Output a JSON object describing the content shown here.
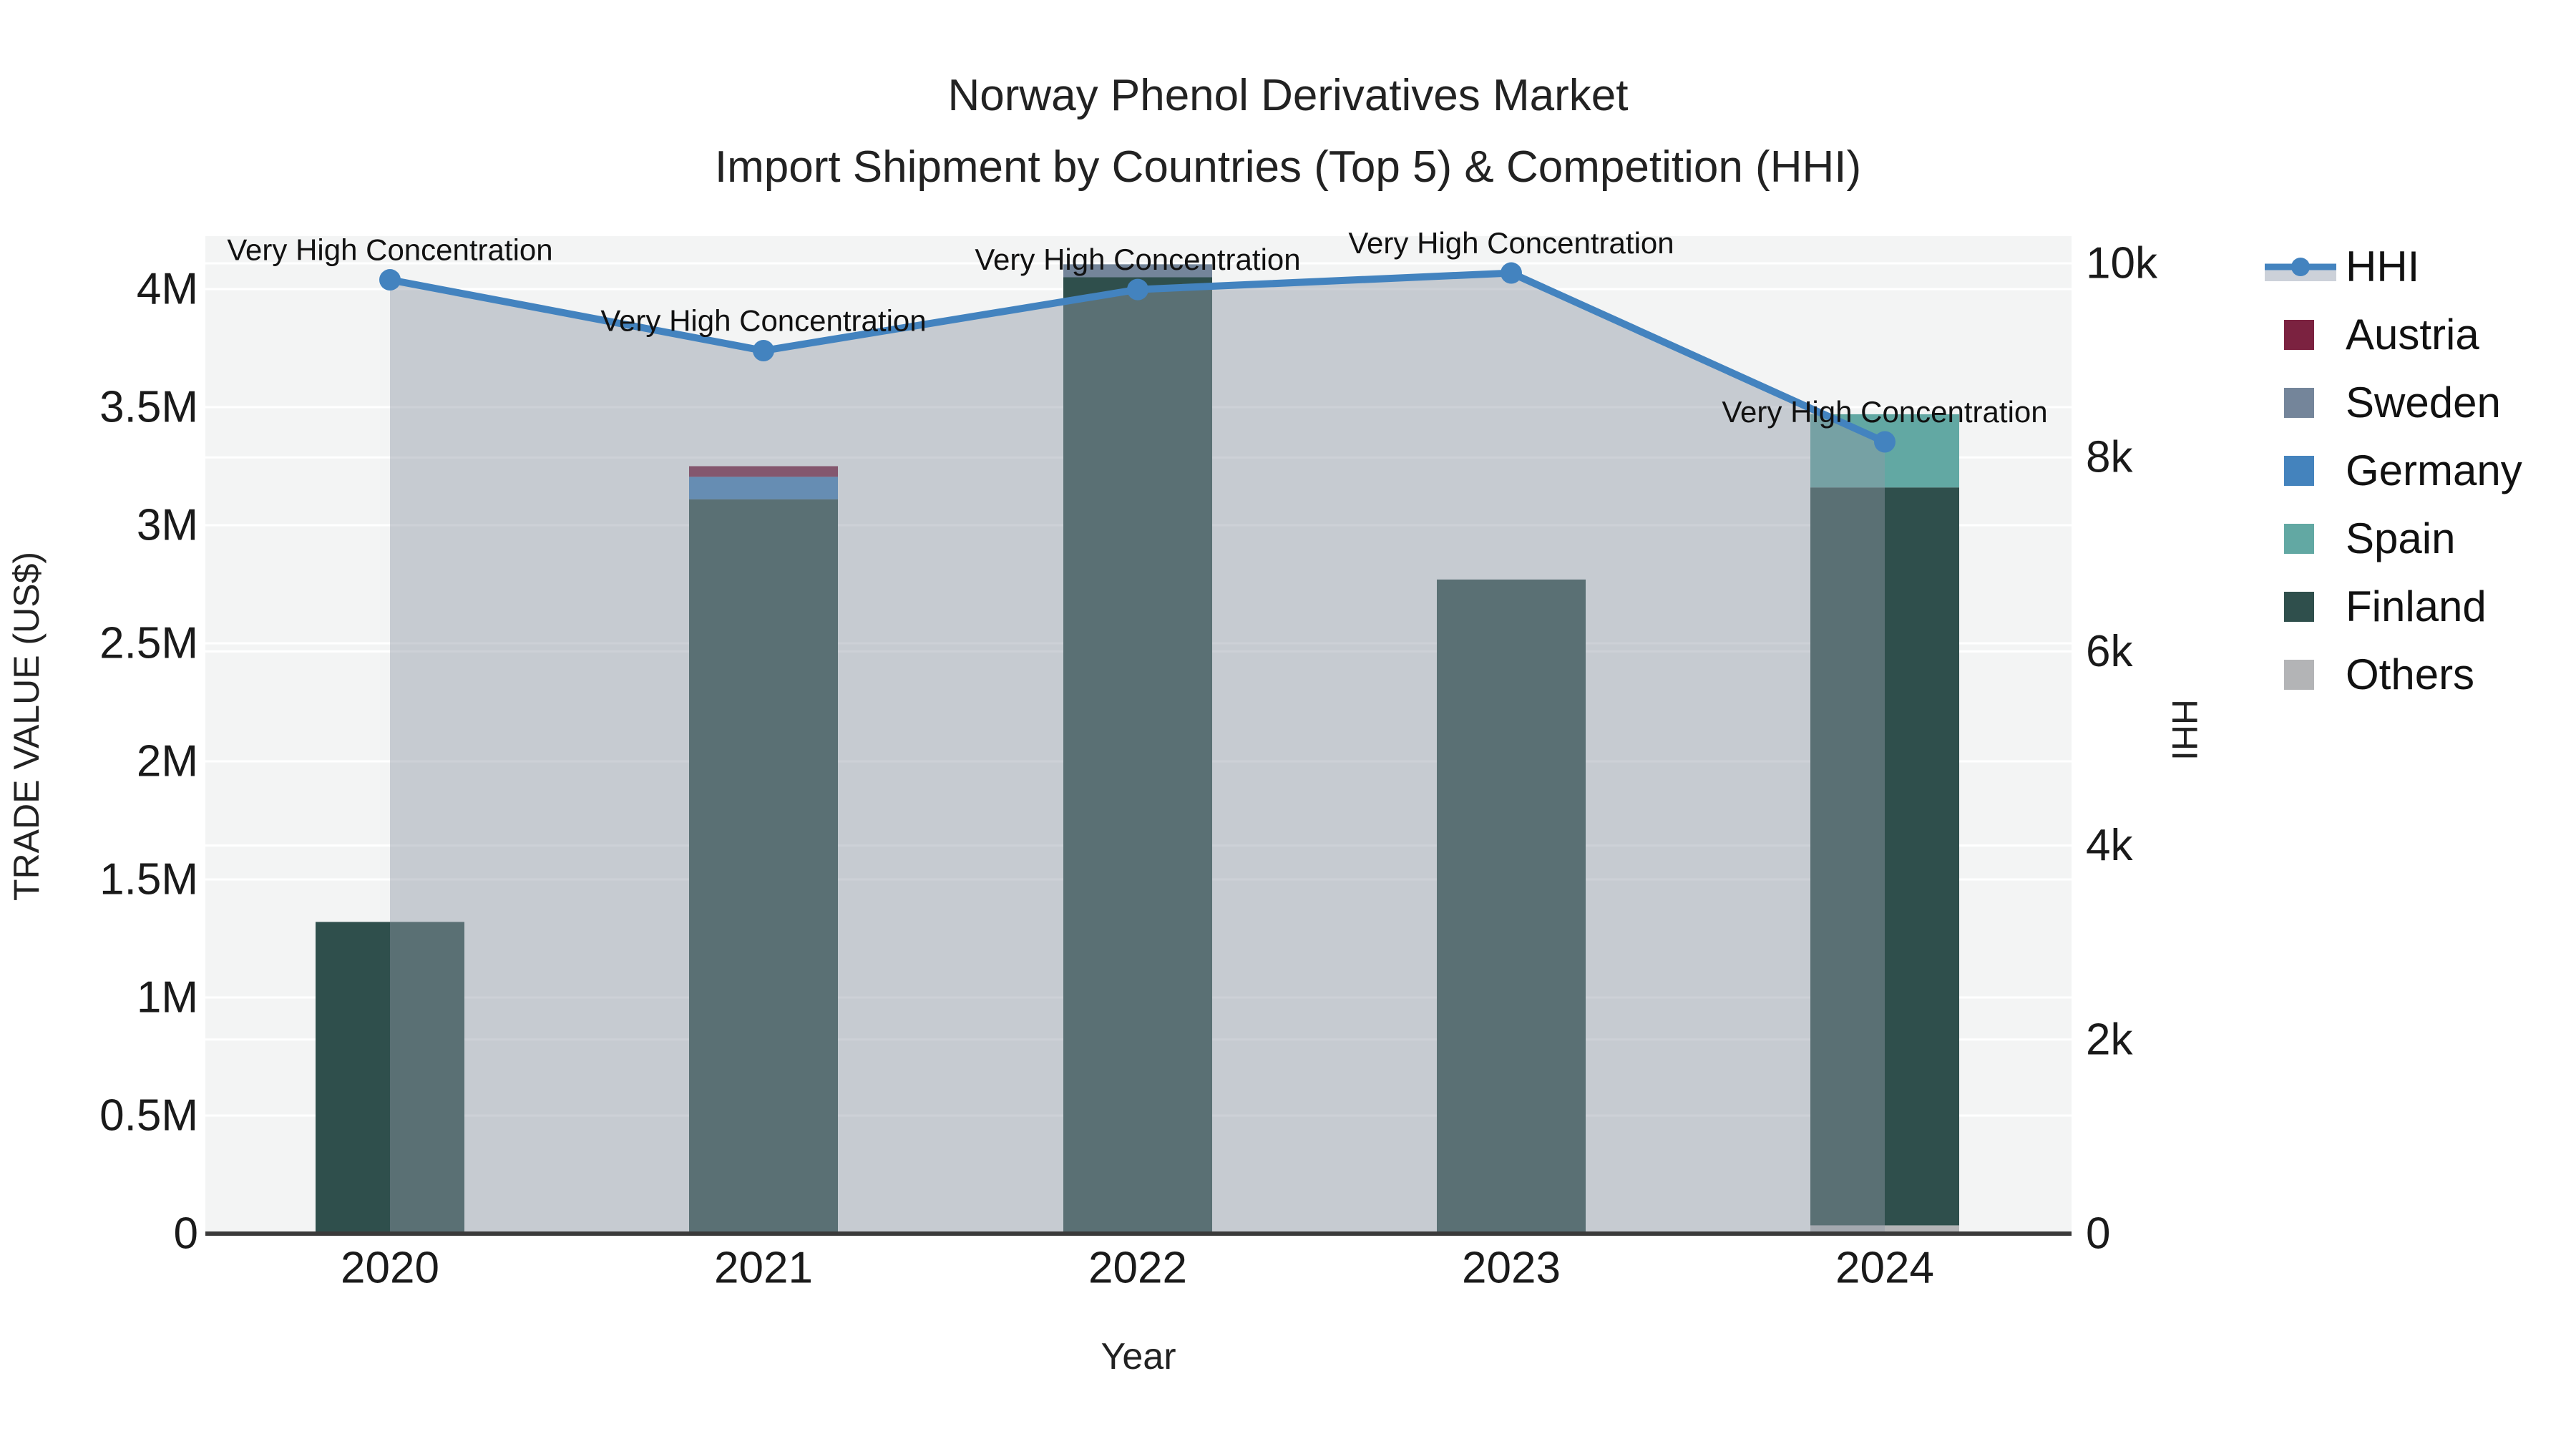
{
  "title": {
    "line1": "Norway Phenol Derivatives Market",
    "line2": "Import Shipment by Countries (Top 5) & Competition (HHI)"
  },
  "axes": {
    "x": {
      "title": "Year",
      "categories": [
        "2020",
        "2021",
        "2022",
        "2023",
        "2024"
      ]
    },
    "y_left": {
      "title": "TRADE VALUE (US$)",
      "tick_labels": [
        "0",
        "0.5M",
        "1M",
        "1.5M",
        "2M",
        "2.5M",
        "3M",
        "3.5M",
        "4M"
      ],
      "range": [
        0,
        4000000
      ]
    },
    "y_right": {
      "title": "HHI",
      "tick_labels": [
        "0",
        "2k",
        "4k",
        "6k",
        "8k",
        "10k"
      ],
      "range": [
        0,
        10000
      ]
    }
  },
  "legend": {
    "items": [
      {
        "label": "HHI",
        "color": "#4383bf",
        "type": "line"
      },
      {
        "label": "Austria",
        "color": "#7b2240",
        "type": "swatch"
      },
      {
        "label": "Sweden",
        "color": "#74859a",
        "type": "swatch"
      },
      {
        "label": "Germany",
        "color": "#4483bd",
        "type": "swatch"
      },
      {
        "label": "Spain",
        "color": "#62a8a3",
        "type": "swatch"
      },
      {
        "label": "Finland",
        "color": "#2f4f4c",
        "type": "swatch"
      },
      {
        "label": "Others",
        "color": "#b3b4b6",
        "type": "swatch"
      }
    ]
  },
  "colors": {
    "plot_bg": "#f3f4f4",
    "grid": "#ffffff",
    "axis_line": "#3a3a3a",
    "fill_overlay": "rgba(144,152,166,0.45)",
    "hhi_line": "#4383bf"
  },
  "chart_data": {
    "type": "bar+line",
    "title": "Norway Phenol Derivatives Market — Import Shipment by Countries (Top 5) & Competition (HHI)",
    "xlabel": "Year",
    "ylabel_left": "TRADE VALUE (US$)",
    "ylabel_right": "HHI",
    "categories": [
      "2020",
      "2021",
      "2022",
      "2023",
      "2024"
    ],
    "ylim_left": [
      0,
      4000000
    ],
    "ylim_right": [
      0,
      10000
    ],
    "stack_order": [
      "Others",
      "Finland",
      "Spain",
      "Germany",
      "Sweden",
      "Austria"
    ],
    "series": [
      {
        "name": "Austria",
        "type": "bar",
        "color": "#7b2240",
        "values": [
          0,
          45000,
          0,
          0,
          0
        ]
      },
      {
        "name": "Sweden",
        "type": "bar",
        "color": "#74859a",
        "values": [
          0,
          0,
          55000,
          0,
          0
        ]
      },
      {
        "name": "Germany",
        "type": "bar",
        "color": "#4483bd",
        "values": [
          0,
          95000,
          0,
          0,
          0
        ]
      },
      {
        "name": "Spain",
        "type": "bar",
        "color": "#62a8a3",
        "values": [
          0,
          0,
          0,
          0,
          310000
        ]
      },
      {
        "name": "Finland",
        "type": "bar",
        "color": "#2f4f4c",
        "values": [
          1320000,
          3110000,
          4050000,
          2770000,
          3125000
        ]
      },
      {
        "name": "Others",
        "type": "bar",
        "color": "#b3b4b6",
        "values": [
          0,
          0,
          0,
          0,
          35000
        ]
      }
    ],
    "line_series": {
      "name": "HHI",
      "axis": "right",
      "color": "#4383bf",
      "fill_color": "rgba(144,152,166,0.45)",
      "values": [
        9830,
        9100,
        9730,
        9900,
        8160
      ]
    },
    "annotations": [
      {
        "x": "2020",
        "text": "Very High Concentration"
      },
      {
        "x": "2021",
        "text": "Very High Concentration"
      },
      {
        "x": "2022",
        "text": "Very High Concentration"
      },
      {
        "x": "2023",
        "text": "Very High Concentration"
      },
      {
        "x": "2024",
        "text": "Very High Concentration"
      }
    ]
  }
}
